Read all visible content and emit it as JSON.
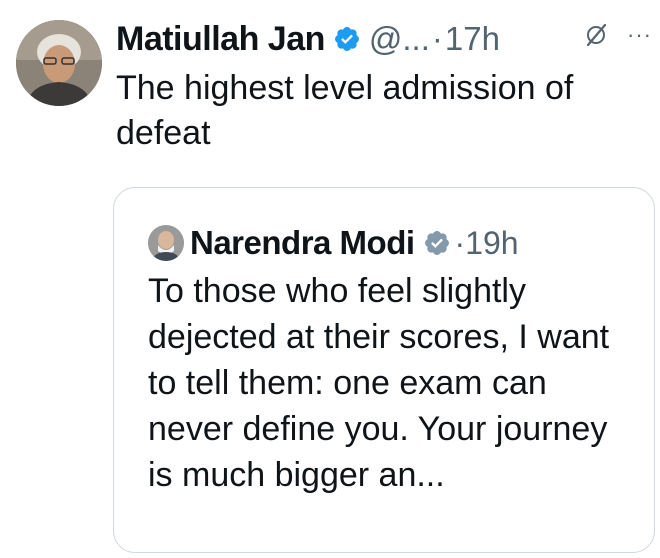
{
  "tweet": {
    "author_name": "Matiullah Jan",
    "handle": "@...",
    "separator": "·",
    "time": "17h",
    "text": "The highest level admission of defeat",
    "more_label": "···"
  },
  "quoted_tweet": {
    "author_name": "Narendra Modi",
    "separator": "·",
    "time": "19h",
    "text": "To those who feel slightly dejected at their scores, I want to tell them: one exam can never define you. Your journey is much bigger an..."
  },
  "colors": {
    "text_primary": "#0f1419",
    "text_secondary": "#536471",
    "verified_blue": "#1d9bf0",
    "verified_gray": "#829aab",
    "border": "#cfd9de"
  },
  "icons": {
    "verified": "verified-badge-icon",
    "grok": "grok-icon",
    "more": "more-icon"
  }
}
